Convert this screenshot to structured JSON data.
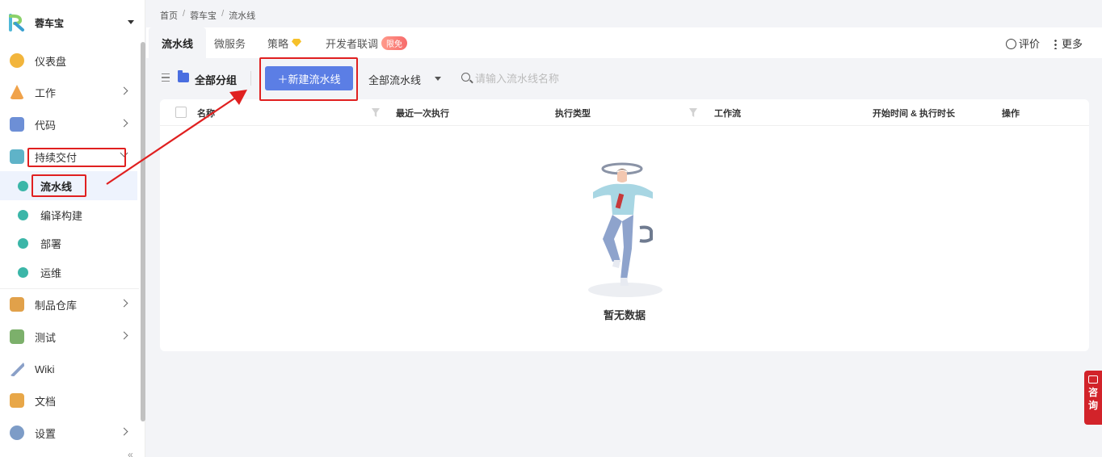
{
  "project": {
    "name": "蓉车宝"
  },
  "sidebar": {
    "items": [
      {
        "label": "仪表盘",
        "icon": "dashboard-icon",
        "color": "#f2b53c"
      },
      {
        "label": "工作",
        "icon": "work-icon",
        "color": "#f0a24a"
      },
      {
        "label": "代码",
        "icon": "code-icon",
        "color": "#6d8fd6"
      },
      {
        "label": "持续交付",
        "icon": "delivery-icon",
        "color": "#5fb3c8"
      },
      {
        "label": "制品仓库",
        "icon": "artifact-icon",
        "color": "#e1a14a"
      },
      {
        "label": "测试",
        "icon": "test-icon",
        "color": "#7cb06b"
      },
      {
        "label": "Wiki",
        "icon": "wiki-icon",
        "color": "#8aa0c8"
      },
      {
        "label": "文档",
        "icon": "docs-icon",
        "color": "#e8a748"
      },
      {
        "label": "设置",
        "icon": "settings-icon",
        "color": "#7d9cc7"
      }
    ],
    "sub_items": [
      {
        "label": "流水线",
        "icon": "pipeline-icon",
        "color": "#3bb6a8"
      },
      {
        "label": "编译构建",
        "icon": "build-icon",
        "color": "#3bb6a8"
      },
      {
        "label": "部署",
        "icon": "deploy-icon",
        "color": "#3bb6a8"
      },
      {
        "label": "运维",
        "icon": "ops-icon",
        "color": "#3bb6a8"
      }
    ],
    "collapse_label": "«"
  },
  "breadcrumb": {
    "items": [
      "首页",
      "蓉车宝",
      "流水线"
    ],
    "separator": "/"
  },
  "tabs": [
    {
      "label": "流水线"
    },
    {
      "label": "微服务"
    },
    {
      "label": "策略"
    },
    {
      "label": "开发者联调",
      "badge": "限免"
    }
  ],
  "header_tools": {
    "rate_label": "评价",
    "more_label": "更多"
  },
  "toolbar": {
    "group_label": "全部分组",
    "new_button_label": "＋新建流水线",
    "filter_label": "全部流水线",
    "search_placeholder": "请输入流水线名称"
  },
  "table": {
    "columns": [
      "名称",
      "最近一次执行",
      "执行类型",
      "工作流",
      "开始时间 & 执行时长",
      "操作"
    ],
    "rows": [],
    "empty_text": "暂无数据"
  },
  "consult": {
    "label": "咨询"
  },
  "colors": {
    "accent": "#5b7ee5",
    "annotation": "#e02020",
    "consult": "#d2232a"
  }
}
